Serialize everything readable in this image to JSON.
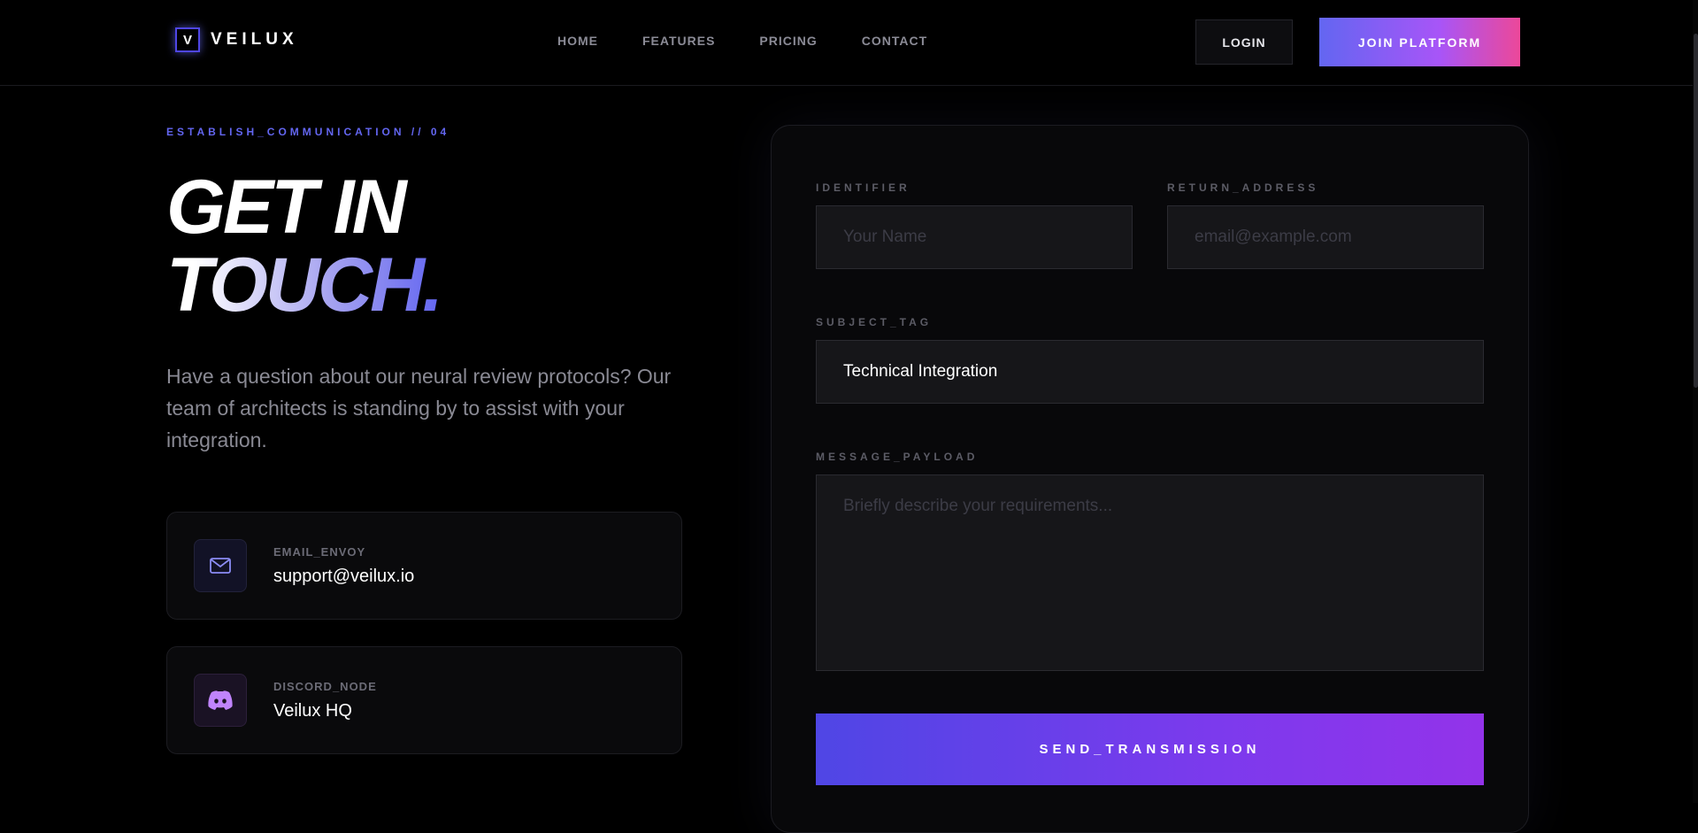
{
  "header": {
    "logo_mark": "V",
    "logo_text": "VEILUX",
    "nav": [
      "HOME",
      "FEATURES",
      "PRICING",
      "CONTACT"
    ],
    "login_label": "LOGIN",
    "join_label": "JOIN PLATFORM"
  },
  "hero": {
    "eyebrow": "ESTABLISH_COMMUNICATION // 04",
    "title_line1": "GET IN",
    "title_line2": "TOUCH.",
    "description": "Have a question about our neural review protocols? Our team of architects is standing by to assist with your integration."
  },
  "contacts": [
    {
      "icon": "mail-icon",
      "label": "EMAIL_ENVOY",
      "value": "support@veilux.io"
    },
    {
      "icon": "discord-icon",
      "label": "DISCORD_NODE",
      "value": "Veilux HQ"
    }
  ],
  "form": {
    "identifier": {
      "label": "IDENTIFIER",
      "placeholder": "Your Name",
      "value": ""
    },
    "return_address": {
      "label": "RETURN_ADDRESS",
      "placeholder": "email@example.com",
      "value": ""
    },
    "subject_tag": {
      "label": "SUBJECT_TAG",
      "value": "Technical Integration"
    },
    "message_payload": {
      "label": "MESSAGE_PAYLOAD",
      "placeholder": "Briefly describe your requirements...",
      "value": ""
    },
    "submit_label": "SEND_TRANSMISSION"
  },
  "colors": {
    "accent": "#6366f1",
    "gradient_end": "#ec4899",
    "submit_gradient_end": "#9333ea"
  }
}
